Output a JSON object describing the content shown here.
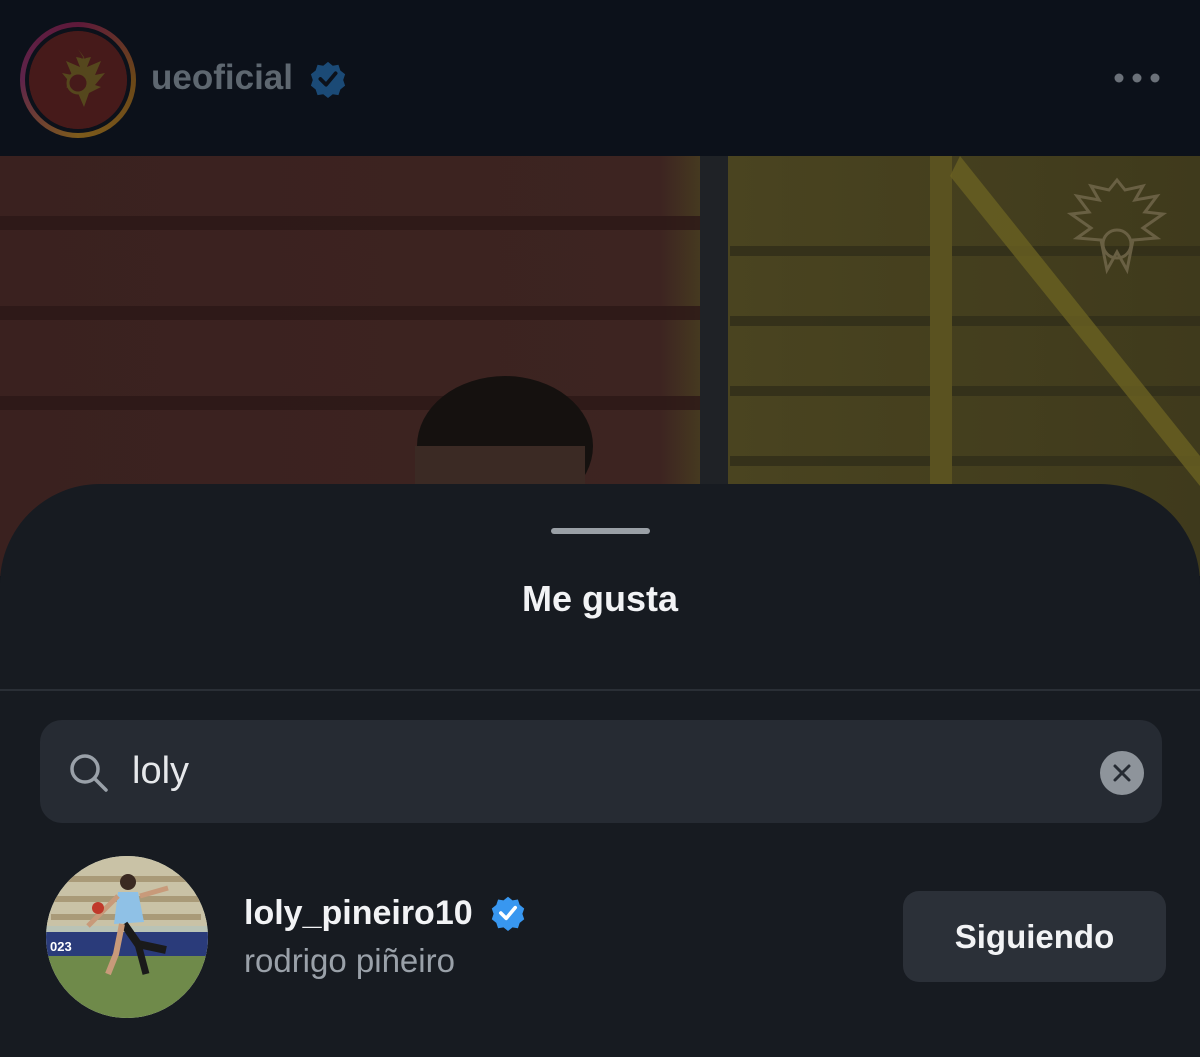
{
  "header": {
    "handle": "ueoficial",
    "verified": true,
    "avatar_icon": "eagle-crest-logo",
    "more_icon": "more-dots-icon"
  },
  "sheet": {
    "title": "Me gusta"
  },
  "search": {
    "value": "loly",
    "icon": "search-icon",
    "clear_icon": "close-icon"
  },
  "results": [
    {
      "username": "loly_pineiro10",
      "full_name": "rodrigo piñeiro",
      "verified": true,
      "button_label": "Siguiendo"
    }
  ],
  "colors": {
    "verified_blue": "#3897f0",
    "sheet_bg": "#171b21",
    "search_bg": "#262b33",
    "button_bg": "#2b3038"
  }
}
